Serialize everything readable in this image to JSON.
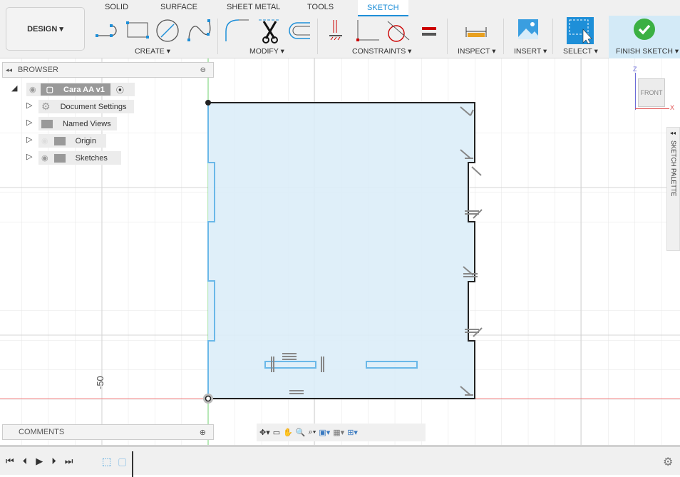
{
  "toolbar": {
    "design_label": "DESIGN",
    "tabs": [
      {
        "label": "SOLID"
      },
      {
        "label": "SURFACE"
      },
      {
        "label": "SHEET METAL"
      },
      {
        "label": "TOOLS"
      },
      {
        "label": "SKETCH",
        "active": true
      }
    ],
    "groups": {
      "create": "CREATE",
      "modify": "MODIFY",
      "constraints": "CONSTRAINTS",
      "inspect": "INSPECT",
      "insert": "INSERT",
      "select": "SELECT",
      "finish": "FINISH SKETCH"
    },
    "accent": "#1e8fd8"
  },
  "browser": {
    "title": "BROWSER",
    "root": "Cara AA v1",
    "items": [
      {
        "label": "Document Settings",
        "icon": "gear-icon"
      },
      {
        "label": "Named Views",
        "icon": "folder-icon"
      },
      {
        "label": "Origin",
        "icon": "folder-icon",
        "hidden": true
      },
      {
        "label": "Sketches",
        "icon": "folder-icon"
      }
    ]
  },
  "comments": {
    "title": "COMMENTS"
  },
  "viewcube": {
    "face": "FRONT",
    "axis_z": "Z",
    "axis_x": "X"
  },
  "sketch_palette": {
    "label": "SKETCH PALETTE"
  },
  "viewport": {
    "ruler_label": "-50",
    "profile_fill": "#dcedf8"
  }
}
